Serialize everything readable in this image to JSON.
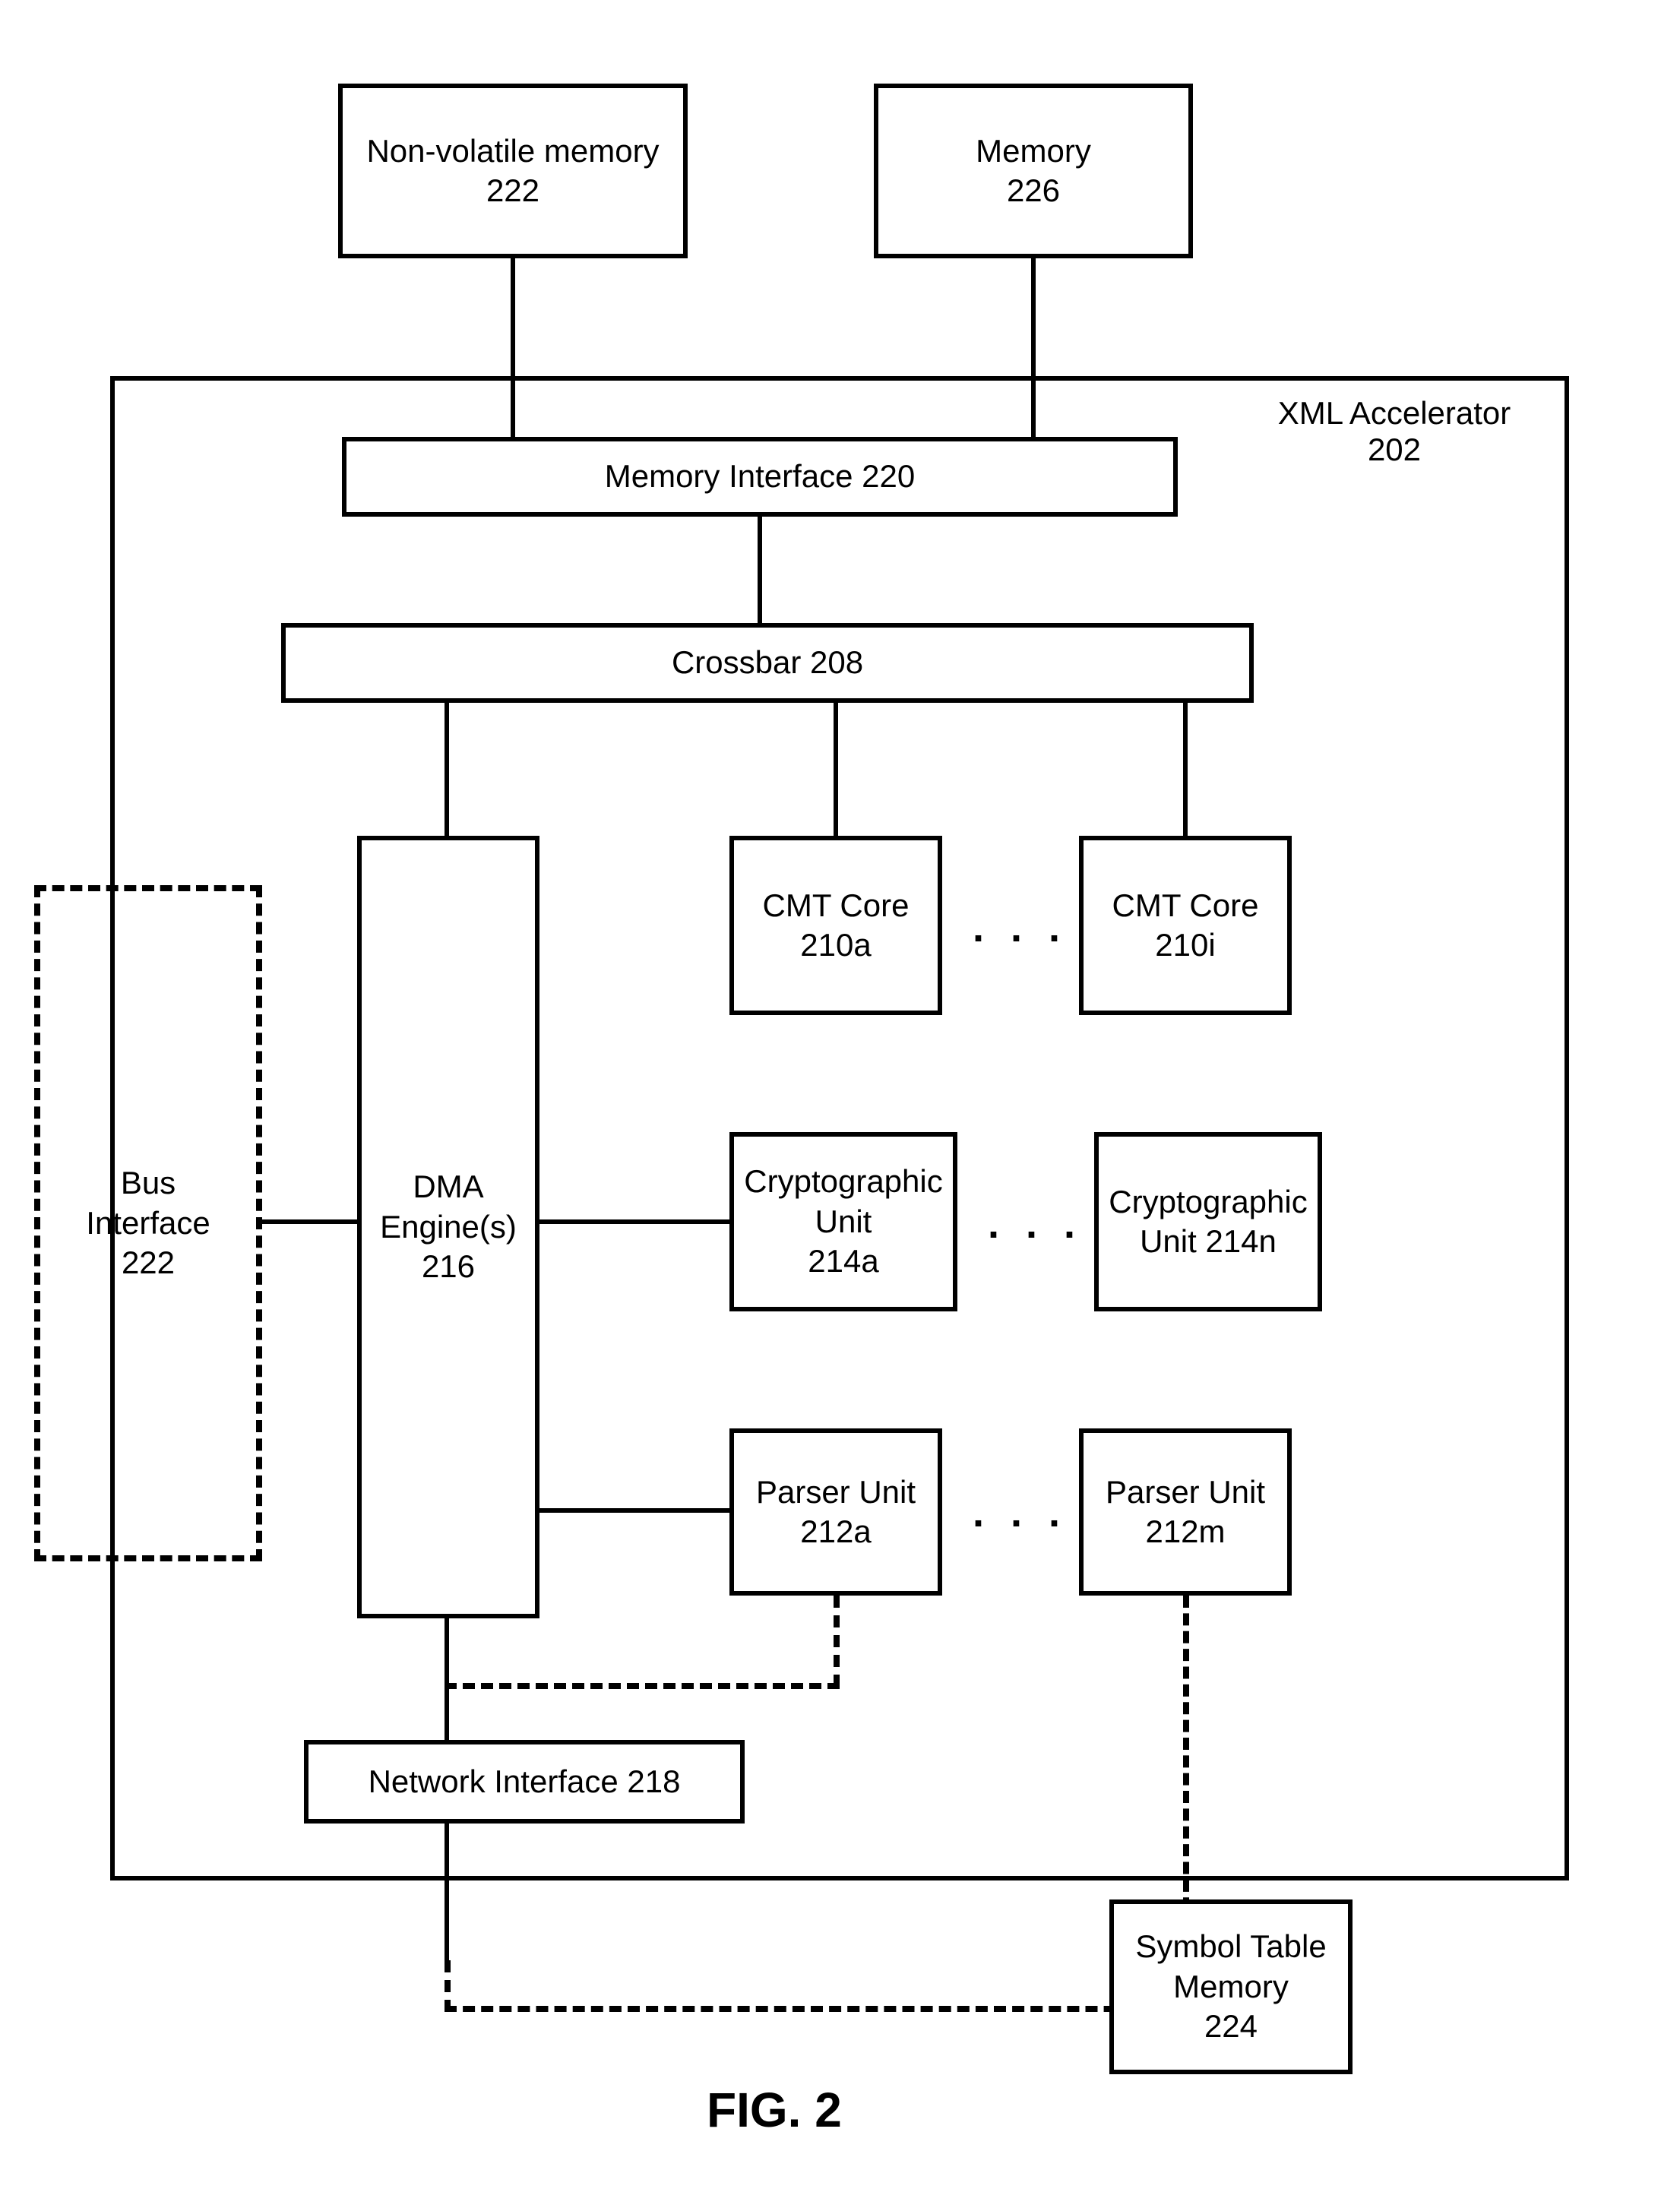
{
  "figure_label": "FIG. 2",
  "external_top": {
    "nvmem": {
      "name": "Non-volatile memory",
      "ref": "222"
    },
    "memory": {
      "name": "Memory",
      "ref": "226"
    }
  },
  "accelerator": {
    "title": "XML Accelerator",
    "ref": "202",
    "mem_if": "Memory Interface 220",
    "crossbar": "Crossbar 208",
    "dma": {
      "name": "DMA",
      "line2": "Engine(s)",
      "ref": "216"
    },
    "cmt_a": {
      "name": "CMT Core",
      "ref": "210a"
    },
    "cmt_i": {
      "name": "CMT Core",
      "ref": "210i"
    },
    "crypto_a": {
      "name": "Cryptographic",
      "line2": "Unit",
      "ref": "214a"
    },
    "crypto_n": {
      "name": "Cryptographic",
      "line2": "Unit 214n"
    },
    "parser_a": {
      "name": "Parser Unit",
      "ref": "212a"
    },
    "parser_m": {
      "name": "Parser Unit",
      "ref": "212m"
    },
    "net_if": "Network Interface 218"
  },
  "bus_if": {
    "name": "Bus",
    "line2": "Interface",
    "ref": "222"
  },
  "symbol_table": {
    "name": "Symbol Table",
    "line2": "Memory",
    "ref": "224"
  },
  "ellipsis": ". . ."
}
